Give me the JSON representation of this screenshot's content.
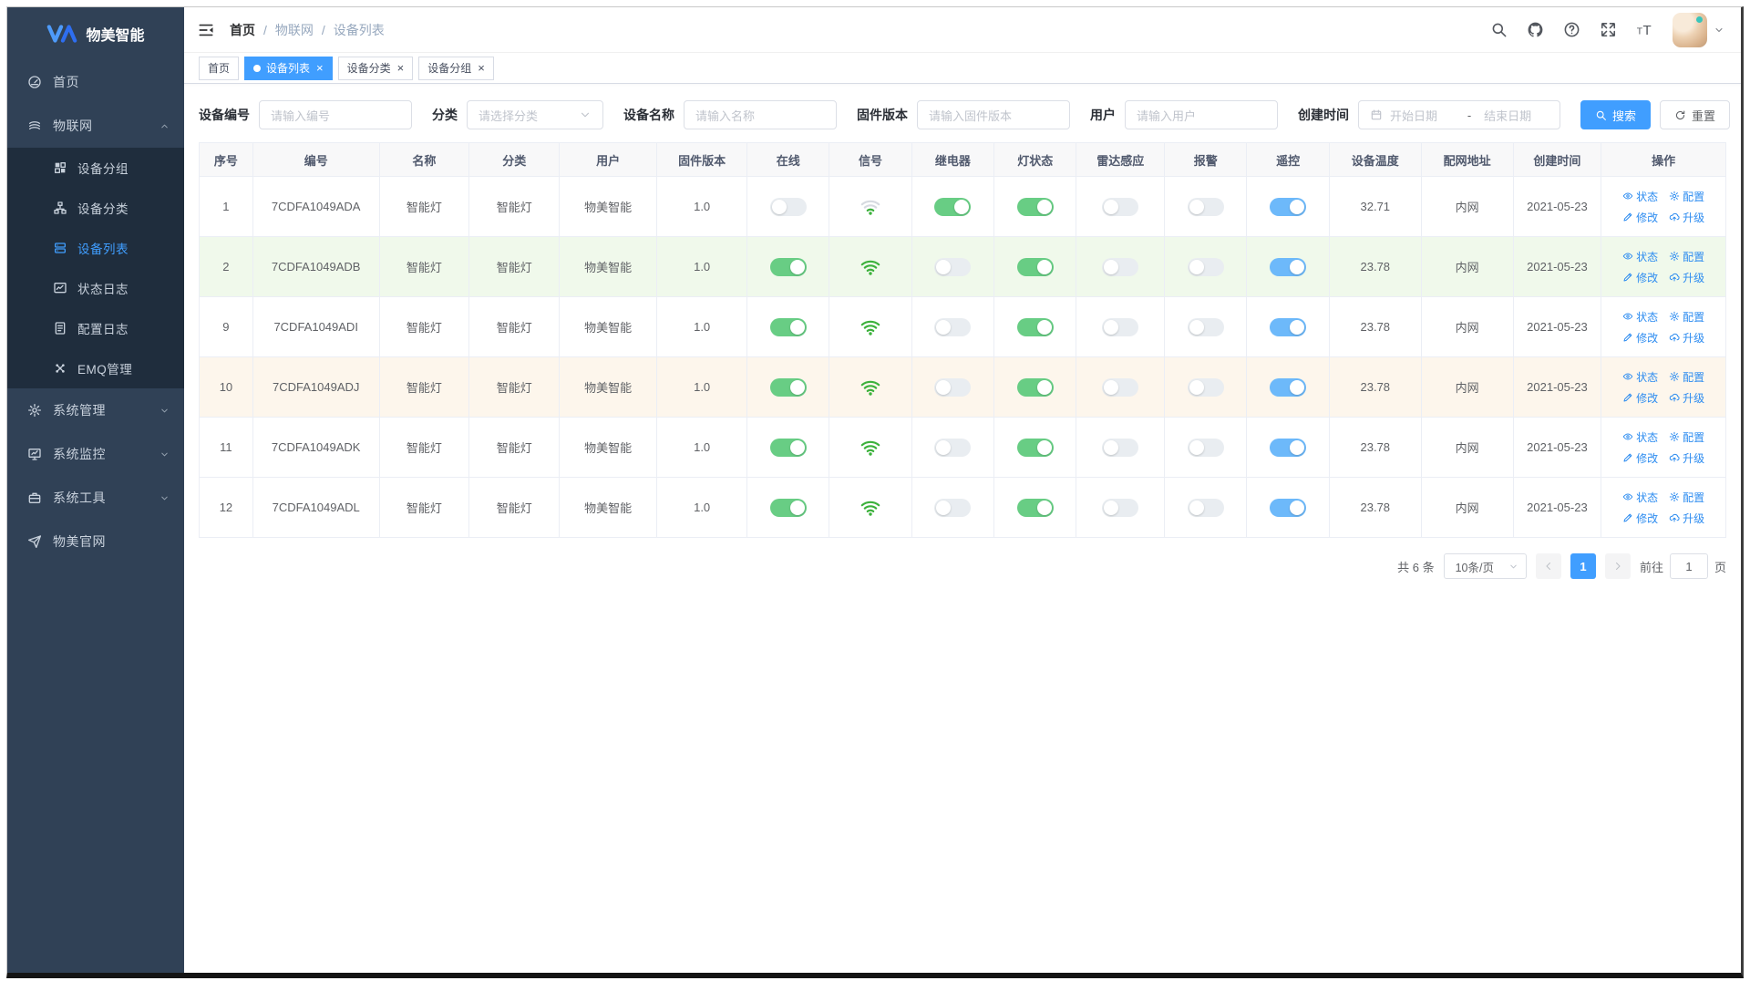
{
  "app": {
    "logo_text": "物美智能"
  },
  "colors": {
    "accent": "#409eff",
    "sidebar_bg": "#304156",
    "submenu_bg": "#1f2d3d",
    "toggle_green": "#68cd84",
    "toggle_blue": "#6db9fa",
    "row_success": "#f0f9eb",
    "row_warning": "#fdf6ec",
    "wifi_green": "#3cb13c",
    "op_link": "#2d8cf0"
  },
  "sidebar": {
    "items": [
      {
        "id": "home",
        "icon": "dashboard-icon",
        "label": "首页",
        "chevron": null,
        "children": null
      },
      {
        "id": "iot",
        "icon": "iot-icon",
        "label": "物联网",
        "chevron": "up",
        "children": [
          {
            "id": "device-group",
            "icon": "grid-icon",
            "label": "设备分组",
            "active": false
          },
          {
            "id": "device-category",
            "icon": "tree-icon",
            "label": "设备分类",
            "active": false
          },
          {
            "id": "device-list",
            "icon": "list-icon",
            "label": "设备列表",
            "active": true
          },
          {
            "id": "status-log",
            "icon": "chart-icon",
            "label": "状态日志",
            "active": false
          },
          {
            "id": "config-log",
            "icon": "doc-icon",
            "label": "配置日志",
            "active": false
          },
          {
            "id": "emq-manage",
            "icon": "nodes-icon",
            "label": "EMQ管理",
            "active": false
          }
        ]
      },
      {
        "id": "system-manage",
        "icon": "gear-icon",
        "label": "系统管理",
        "chevron": "down",
        "children": null
      },
      {
        "id": "system-monitor",
        "icon": "monitor-icon",
        "label": "系统监控",
        "chevron": "down",
        "children": null
      },
      {
        "id": "system-tools",
        "icon": "toolbox-icon",
        "label": "系统工具",
        "chevron": "down",
        "children": null
      },
      {
        "id": "official-site",
        "icon": "plane-icon",
        "label": "物美官网",
        "chevron": null,
        "children": null
      }
    ]
  },
  "header": {
    "breadcrumb": [
      "首页",
      "物联网",
      "设备列表"
    ],
    "actions": [
      {
        "id": "header-search",
        "icon": "search-icon"
      },
      {
        "id": "github-link",
        "icon": "github-icon"
      },
      {
        "id": "help",
        "icon": "question-icon"
      },
      {
        "id": "fullscreen",
        "icon": "fullscreen-icon"
      },
      {
        "id": "font-size",
        "icon": "fontsize-icon"
      }
    ]
  },
  "tags": [
    {
      "label": "首页",
      "active": false,
      "closable": false
    },
    {
      "label": "设备列表",
      "active": true,
      "closable": true
    },
    {
      "label": "设备分类",
      "active": false,
      "closable": true
    },
    {
      "label": "设备分组",
      "active": false,
      "closable": true
    }
  ],
  "filter": {
    "fields": [
      {
        "id": "device-code",
        "label": "设备编号",
        "type": "input",
        "placeholder": "请输入编号"
      },
      {
        "id": "category",
        "label": "分类",
        "type": "select",
        "placeholder": "请选择分类"
      },
      {
        "id": "device-name",
        "label": "设备名称",
        "type": "input",
        "placeholder": "请输入名称"
      },
      {
        "id": "firmware",
        "label": "固件版本",
        "type": "input",
        "placeholder": "请输入固件版本"
      },
      {
        "id": "user",
        "label": "用户",
        "type": "input",
        "placeholder": "请输入用户"
      },
      {
        "id": "created",
        "label": "创建时间",
        "type": "daterange",
        "start_placeholder": "开始日期",
        "separator": "-",
        "end_placeholder": "结束日期"
      }
    ],
    "search_label": "搜索",
    "reset_label": "重置"
  },
  "table": {
    "columns": [
      "序号",
      "编号",
      "名称",
      "分类",
      "用户",
      "固件版本",
      "在线",
      "信号",
      "继电器",
      "灯状态",
      "雷达感应",
      "报警",
      "遥控",
      "设备温度",
      "配网地址",
      "创建时间",
      "操作"
    ],
    "ops": [
      {
        "id": "status",
        "label": "状态",
        "icon": "eye-icon"
      },
      {
        "id": "config",
        "label": "配置",
        "icon": "op-gear-icon"
      },
      {
        "id": "edit",
        "label": "修改",
        "icon": "edit-icon"
      },
      {
        "id": "upgrade",
        "label": "升级",
        "icon": "cloud-up-icon"
      }
    ],
    "rows": [
      {
        "index": "1",
        "code": "7CDFA1049ADA",
        "name": "智能灯",
        "category": "智能灯",
        "user": "物美智能",
        "firmware": "1.0",
        "online": false,
        "signal": "weak",
        "relay": true,
        "light": true,
        "radar": false,
        "alarm": false,
        "remote": true,
        "temperature": "32.71",
        "network": "内网",
        "created": "2021-05-23",
        "highlight": "none"
      },
      {
        "index": "2",
        "code": "7CDFA1049ADB",
        "name": "智能灯",
        "category": "智能灯",
        "user": "物美智能",
        "firmware": "1.0",
        "online": true,
        "signal": "strong",
        "relay": false,
        "light": true,
        "radar": false,
        "alarm": false,
        "remote": true,
        "temperature": "23.78",
        "network": "内网",
        "created": "2021-05-23",
        "highlight": "success"
      },
      {
        "index": "9",
        "code": "7CDFA1049ADI",
        "name": "智能灯",
        "category": "智能灯",
        "user": "物美智能",
        "firmware": "1.0",
        "online": true,
        "signal": "strong",
        "relay": false,
        "light": true,
        "radar": false,
        "alarm": false,
        "remote": true,
        "temperature": "23.78",
        "network": "内网",
        "created": "2021-05-23",
        "highlight": "none"
      },
      {
        "index": "10",
        "code": "7CDFA1049ADJ",
        "name": "智能灯",
        "category": "智能灯",
        "user": "物美智能",
        "firmware": "1.0",
        "online": true,
        "signal": "strong",
        "relay": false,
        "light": true,
        "radar": false,
        "alarm": false,
        "remote": true,
        "temperature": "23.78",
        "network": "内网",
        "created": "2021-05-23",
        "highlight": "warning"
      },
      {
        "index": "11",
        "code": "7CDFA1049ADK",
        "name": "智能灯",
        "category": "智能灯",
        "user": "物美智能",
        "firmware": "1.0",
        "online": true,
        "signal": "strong",
        "relay": false,
        "light": true,
        "radar": false,
        "alarm": false,
        "remote": true,
        "temperature": "23.78",
        "network": "内网",
        "created": "2021-05-23",
        "highlight": "none"
      },
      {
        "index": "12",
        "code": "7CDFA1049ADL",
        "name": "智能灯",
        "category": "智能灯",
        "user": "物美智能",
        "firmware": "1.0",
        "online": true,
        "signal": "strong",
        "relay": false,
        "light": true,
        "radar": false,
        "alarm": false,
        "remote": true,
        "temperature": "23.78",
        "network": "内网",
        "created": "2021-05-23",
        "highlight": "none"
      }
    ]
  },
  "pagination": {
    "total_text": "共 6 条",
    "page_size": "10条/页",
    "current_page": "1",
    "goto_label": "前往",
    "goto_value": "1",
    "goto_suffix": "页"
  }
}
